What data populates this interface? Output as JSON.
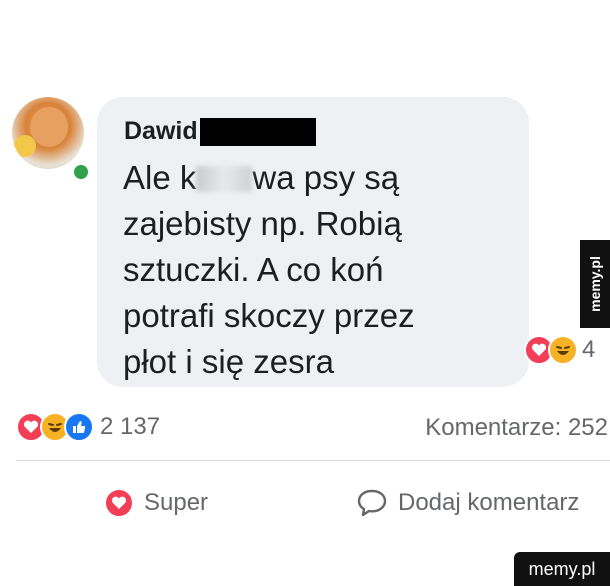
{
  "comment": {
    "author": "Dawid",
    "text_before_blur": "Ale k",
    "text_after_blur": "wa psy są\nzajebisty np. Robią\nsztuczki. A co koń\npotrafi skoczy przez\npłot i się zesra",
    "reaction_count_partial": "4"
  },
  "post": {
    "reactions_count": "2 137",
    "comments_label": "Komentarze: 252"
  },
  "actions": {
    "super_label": "Super",
    "comment_label": "Dodaj komentarz"
  },
  "watermark": {
    "side": "memy.pl",
    "bottom": "memy.pl"
  },
  "icons": {
    "love": "heart-icon",
    "haha": "laugh-icon",
    "like": "thumbs-up-icon",
    "comment": "speech-bubble-icon"
  },
  "colors": {
    "love": "#f33e58",
    "haha": "#f7b125",
    "like": "#1877f2",
    "online": "#31a24c",
    "bubble": "#eef0f3",
    "muted_text": "#65676b"
  }
}
